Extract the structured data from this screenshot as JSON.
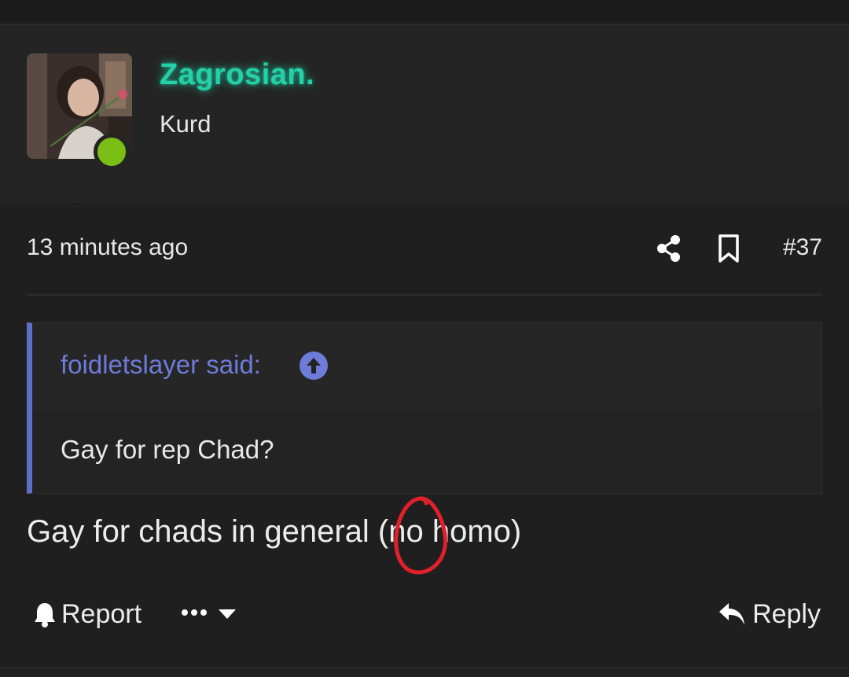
{
  "post": {
    "author": {
      "name": "Zagrosian.",
      "title": "Kurd",
      "online": true,
      "name_color": "#23d0a7",
      "online_color": "#7bbf16"
    },
    "timestamp": "13 minutes ago",
    "number": "#37",
    "quote": {
      "author_line": "foidletslayer said:",
      "text": "Gay for rep Chad?",
      "accent_color": "#5f6ec6"
    },
    "message": {
      "before": "Gay for chads in general (",
      "circled": "no",
      "after": " homo)"
    },
    "actions": {
      "report_label": "Report",
      "more_icon": "ellipsis-caret-icon",
      "reply_label": "Reply"
    },
    "icons": {
      "share": "share-icon",
      "bookmark": "bookmark-icon",
      "jump": "arrow-up-circle-icon",
      "report": "bell-icon",
      "reply": "reply-arrow-icon"
    },
    "annotation_color": "#e0202a"
  }
}
